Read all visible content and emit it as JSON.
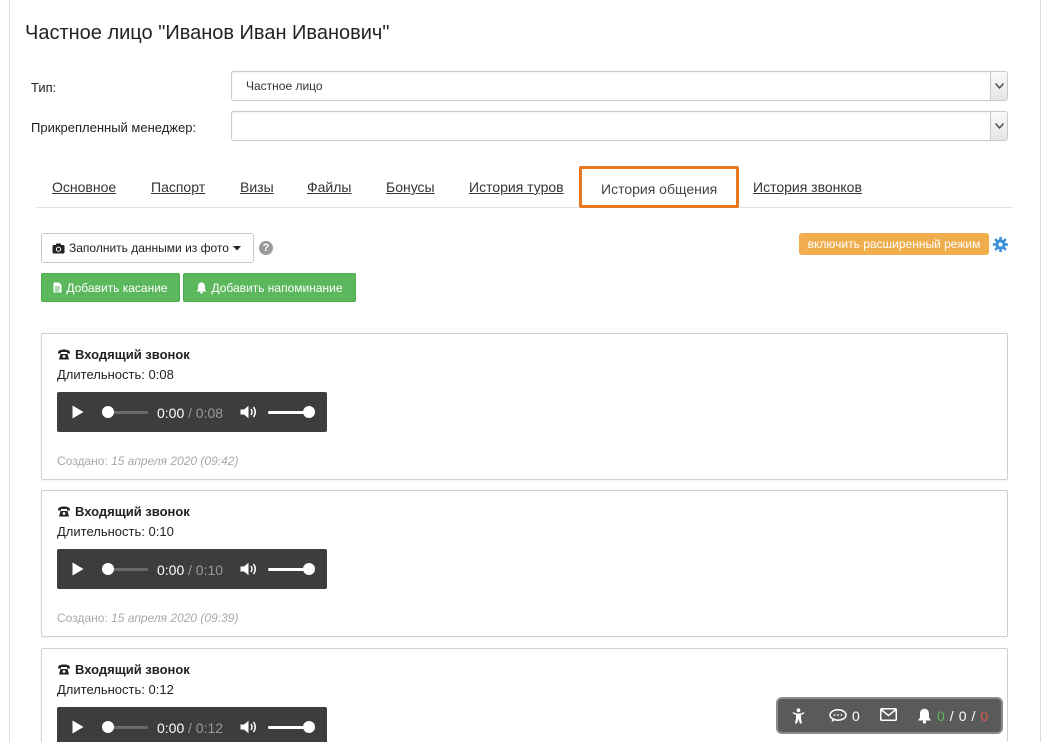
{
  "page": {
    "title": "Частное лицо \"Иванов Иван Иванович\""
  },
  "form": {
    "type_label": "Тип:",
    "type_value": "Частное лицо",
    "manager_label": "Прикрепленный менеджер:",
    "manager_value": ""
  },
  "tabs": [
    {
      "label": "Основное",
      "active": false
    },
    {
      "label": "Паспорт",
      "active": false
    },
    {
      "label": "Визы",
      "active": false
    },
    {
      "label": "Файлы",
      "active": false
    },
    {
      "label": "Бонусы",
      "active": false
    },
    {
      "label": "История туров",
      "active": false
    },
    {
      "label": "История общения",
      "active": true
    },
    {
      "label": "История звонков",
      "active": false
    }
  ],
  "toolbar": {
    "fill_from_photo_label": "Заполнить данными из фото",
    "help_label": "?",
    "add_touch_label": "Добавить касание",
    "add_reminder_label": "Добавить напоминание",
    "advanced_mode_label": "включить расширенный режим"
  },
  "calls": [
    {
      "title": "Входящий звонок",
      "duration_label": "Длительность:",
      "duration": "0:08",
      "current_time": "0:00",
      "total_time": "/ 0:08",
      "progress": 0,
      "volume": 1,
      "created_label": "Создано:",
      "created": "15 апреля 2020 (09:42)"
    },
    {
      "title": "Входящий звонок",
      "duration_label": "Длительность:",
      "duration": "0:10",
      "current_time": "0:00",
      "total_time": "/ 0:10",
      "progress": 0,
      "volume": 1,
      "created_label": "Создано:",
      "created": "15 апреля 2020 (09:39)"
    },
    {
      "title": "Входящий звонок",
      "duration_label": "Длительность:",
      "duration": "0:12",
      "current_time": "0:00",
      "total_time": "/ 0:12",
      "progress": 0,
      "volume": 1,
      "created_label": "Создано:",
      "created": ""
    }
  ],
  "status_bar": {
    "messages_count": "0",
    "reminders_green": "0",
    "sep1": "/",
    "reminders_mid": "0",
    "sep2": "/",
    "reminders_red": "0"
  },
  "colors": {
    "active_tab_border": "#e8761e",
    "success": "#5cb85c",
    "warning": "#f0ad4e",
    "gear": "#3a8fd8",
    "green_count": "#5cb85c",
    "red_count": "#e05a4f"
  }
}
